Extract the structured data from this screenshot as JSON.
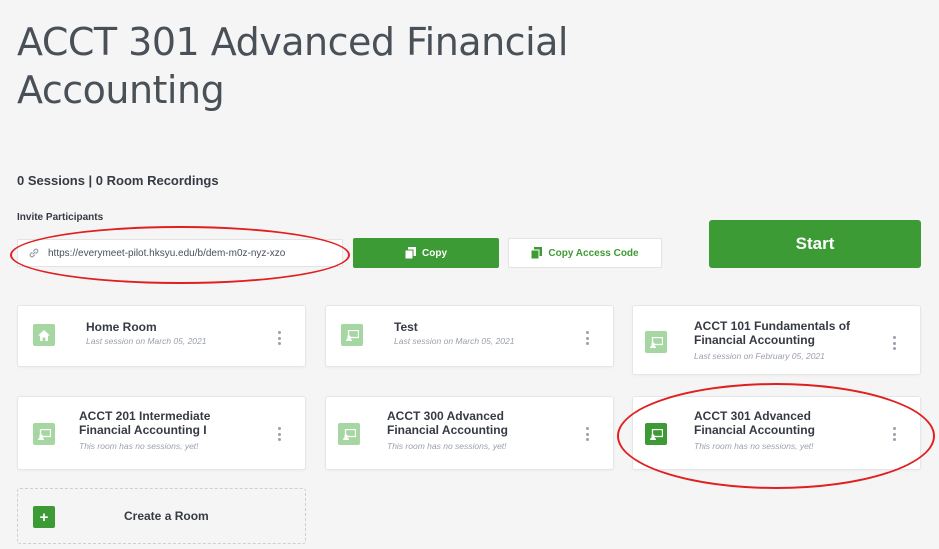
{
  "page": {
    "title": "ACCT 301 Advanced Financial Accounting",
    "stats": "0 Sessions | 0 Room Recordings"
  },
  "invite": {
    "label": "Invite Participants",
    "url": "https://everymeet-pilot.hksyu.edu/b/dem-m0z-nyz-xzo",
    "copy_label": "Copy",
    "copy_code_label": "Copy Access Code",
    "start_label": "Start"
  },
  "rooms": [
    {
      "name": "Home Room",
      "subtitle": "Last session on March 05, 2021",
      "icon": "home-icon"
    },
    {
      "name": "Test",
      "subtitle": "Last session on March 05, 2021",
      "icon": "room-icon"
    },
    {
      "name": "ACCT 101 Fundamentals of Financial Accounting",
      "subtitle": "Last session on February 05, 2021",
      "icon": "room-icon"
    },
    {
      "name": "ACCT 201 Intermediate Financial Accounting I",
      "subtitle": "This room has no sessions, yet!",
      "icon": "room-icon"
    },
    {
      "name": "ACCT 300 Advanced Financial Accounting",
      "subtitle": "This room has no sessions, yet!",
      "icon": "room-icon"
    },
    {
      "name": "ACCT 301 Advanced Financial Accounting",
      "subtitle": "This room has no sessions, yet!",
      "icon": "room-icon",
      "active": true
    }
  ],
  "create_room": {
    "label": "Create a Room",
    "icon": "plus-icon"
  },
  "colors": {
    "accent": "#3d9b35",
    "accent_light": "#a6d6a1",
    "annotation": "#e02020"
  }
}
